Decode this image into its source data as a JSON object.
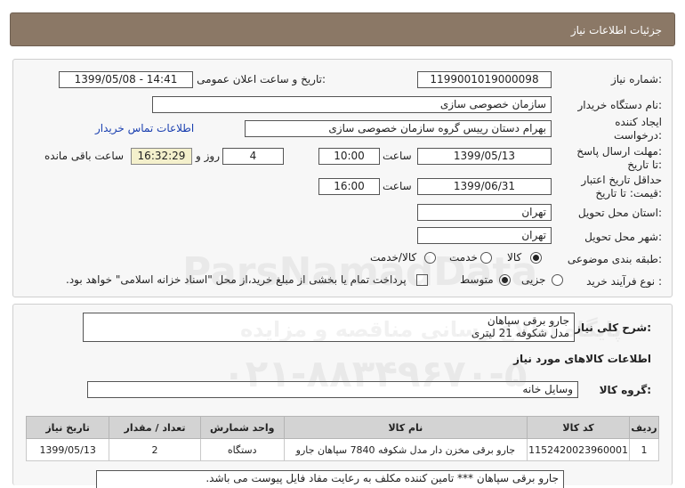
{
  "header": {
    "title": "جزئیات اطلاعات نیاز"
  },
  "info": {
    "need_number_label": "شماره نیاز:",
    "need_number": "1199001019000098",
    "announce_label": "تاریخ و ساعت اعلان عمومی:",
    "announce_value": "1399/05/08 - 14:41",
    "buyer_label": "نام دستگاه خریدار:",
    "buyer_value": "سازمان خصوصی سازی",
    "creator_label_1": "ایجاد کننده",
    "creator_label_2": "درخواست:",
    "creator_value": "بهرام دستان رییس گروه سازمان خصوصی سازی",
    "contact_link": "اطلاعات تماس خریدار",
    "send_label_1": "مهلت ارسال پاسخ:",
    "send_label_2": "تا تاریخ:",
    "send_date": "1399/05/13",
    "time_label": "ساعت",
    "send_time": "10:00",
    "days_value": "4",
    "days_label": "روز و",
    "remaining_time": "16:32:29",
    "remaining_label": "ساعت باقی مانده",
    "validity_label_1": "حداقل تاریخ اعتبار",
    "validity_label_2": "قیمت: تا تاریخ:",
    "validity_date": "1399/06/31",
    "validity_time": "16:00",
    "province_label": "استان محل تحویل:",
    "province_value": "تهران",
    "city_label": "شهر محل تحویل:",
    "city_value": "تهران",
    "category_label": "طبقه بندی موضوعی:",
    "category_options": [
      "کالا",
      "خدمت",
      "کالا/خدمت"
    ],
    "category_selected": "کالا",
    "process_label": "نوع فرآیند خرید :",
    "process_options": [
      "جزیی",
      "متوسط"
    ],
    "process_selected": "متوسط",
    "payment_note": "پرداخت تمام یا بخشی از مبلغ خرید،از محل \"اسناد خزانه اسلامی\" خواهد بود."
  },
  "description": {
    "label": "شرح کلی نیاز:",
    "line1": "جارو برقی سپاهان",
    "line2": "مدل شکوفه 21 لیتری"
  },
  "goods_section": {
    "title": "اطلاعات کالاهای مورد نیاز",
    "group_label": "گروه کالا:",
    "group_value": "وسایل خانه"
  },
  "table": {
    "headers": [
      "ردیف",
      "کد کالا",
      "نام کالا",
      "واحد شمارش",
      "تعداد / مقدار",
      "تاریخ نیاز"
    ],
    "rows": [
      {
        "row": "1",
        "code": "1152420023960001",
        "name": "جارو برقی مخزن دار مدل شکوفه 7840 سپاهان جارو",
        "unit": "دستگاه",
        "qty": "2",
        "date": "1399/05/13"
      }
    ]
  },
  "note": "جارو برقی سپاهان *** تامین کننده مکلف به رعایت مفاد فایل پیوست می باشد.",
  "watermark": {
    "text1": "ParsNamadData",
    "text2": "پایگاه اطلاع رسانی مناقصه و مزایده",
    "text3": "۰۲۱-۸۸۳۴۹۶۷۰-۵"
  }
}
